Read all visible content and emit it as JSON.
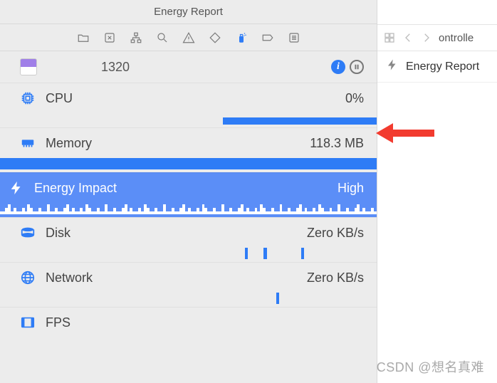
{
  "window": {
    "title": "Energy Report"
  },
  "process": {
    "pid": "1320"
  },
  "metrics": {
    "cpu": {
      "label": "CPU",
      "value": "0%"
    },
    "memory": {
      "label": "Memory",
      "value": "118.3 MB"
    },
    "energy": {
      "label": "Energy Impact",
      "value": "High"
    },
    "disk": {
      "label": "Disk",
      "value": "Zero KB/s"
    },
    "network": {
      "label": "Network",
      "value": "Zero KB/s"
    },
    "fps": {
      "label": "FPS",
      "value": ""
    }
  },
  "right": {
    "crumb": "ontrolle",
    "row_label": "Energy Report"
  },
  "watermark": "CSDN @想名真难",
  "colors": {
    "accent": "#2e7cf6",
    "selected_bg": "#5b8ef7",
    "arrow": "#f23b2f"
  }
}
